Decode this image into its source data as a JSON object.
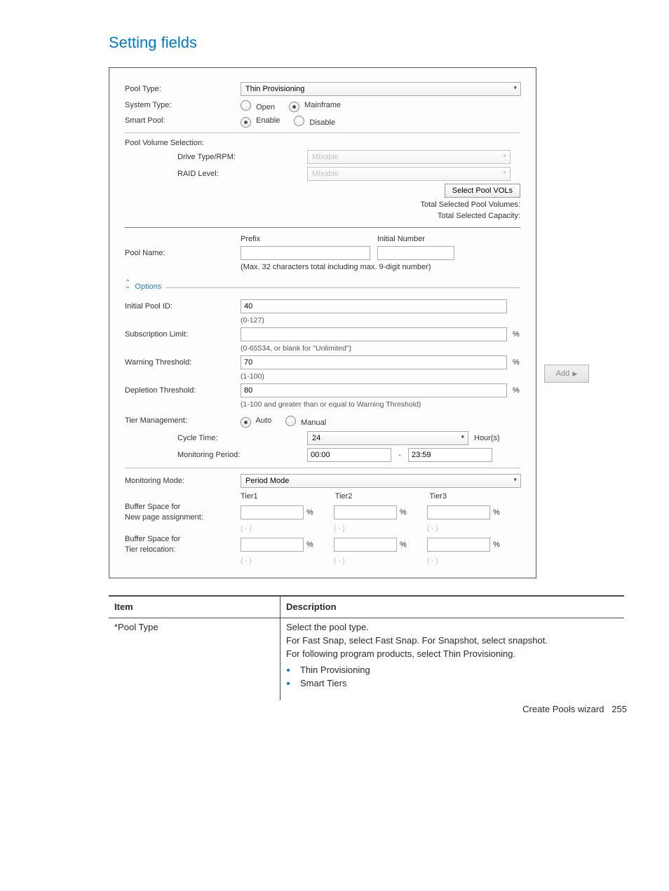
{
  "heading": "Setting fields",
  "form": {
    "pool_type": {
      "label": "Pool Type:",
      "value": "Thin Provisioning"
    },
    "system_type": {
      "label": "System Type:",
      "options": [
        "Open",
        "Mainframe"
      ],
      "selected": "Mainframe"
    },
    "smart_pool": {
      "label": "Smart Pool:",
      "options": [
        "Enable",
        "Disable"
      ],
      "selected": "Enable"
    },
    "pool_vol_sel": {
      "label": "Pool Volume Selection:",
      "drive_type": {
        "label": "Drive Type/RPM:",
        "value": "Mixable"
      },
      "raid_level": {
        "label": "RAID Level:",
        "value": "Mixable"
      },
      "select_btn": "Select Pool VOLs",
      "total_vols": "Total Selected Pool Volumes:",
      "total_cap": "Total Selected Capacity:"
    },
    "pool_name": {
      "label": "Pool Name:",
      "prefix_head": "Prefix",
      "initial_head": "Initial Number",
      "hint": "(Max. 32 characters total including max. 9-digit number)"
    },
    "options_label": "Options",
    "initial_pool_id": {
      "label": "Initial Pool ID:",
      "value": "40",
      "hint": "(0-127)"
    },
    "sub_limit": {
      "label": "Subscription Limit:",
      "value": "",
      "suffix": "%",
      "hint": "(0-65534, or blank for \"Unlimited\")"
    },
    "warn_thresh": {
      "label": "Warning Threshold:",
      "value": "70",
      "suffix": "%",
      "hint": "(1-100)"
    },
    "depl_thresh": {
      "label": "Depletion Threshold:",
      "value": "80",
      "suffix": "%",
      "hint": "(1-100 and greater than or equal to Warning Threshold)"
    },
    "tier_mgmt": {
      "label": "Tier Management:",
      "options": [
        "Auto",
        "Manual"
      ],
      "selected": "Auto"
    },
    "cycle_time": {
      "label": "Cycle Time:",
      "value": "24",
      "unit": "Hour(s)"
    },
    "mon_period": {
      "label": "Monitoring Period:",
      "from": "00:00",
      "sep": "-",
      "to": "23:59"
    },
    "mon_mode": {
      "label": "Monitoring Mode:",
      "value": "Period Mode"
    },
    "tiers": {
      "head": [
        "Tier1",
        "Tier2",
        "Tier3"
      ],
      "buf_new": {
        "label": "Buffer Space for\nNew page assignment:"
      },
      "buf_rel": {
        "label": "Buffer Space for\nTier relocation:"
      },
      "pct": "%",
      "placeholder": "( - )"
    }
  },
  "add_btn": "Add",
  "table": {
    "headers": [
      "Item",
      "Description"
    ],
    "row1": {
      "item": "*Pool Type",
      "lines": [
        "Select the pool type.",
        "For Fast Snap, select Fast Snap. For Snapshot, select snapshot.",
        "For following program products, select Thin Provisioning."
      ],
      "bullets": [
        "Thin Provisioning",
        "Smart Tiers"
      ]
    }
  },
  "footer": {
    "text": "Create Pools wizard",
    "page": "255"
  }
}
